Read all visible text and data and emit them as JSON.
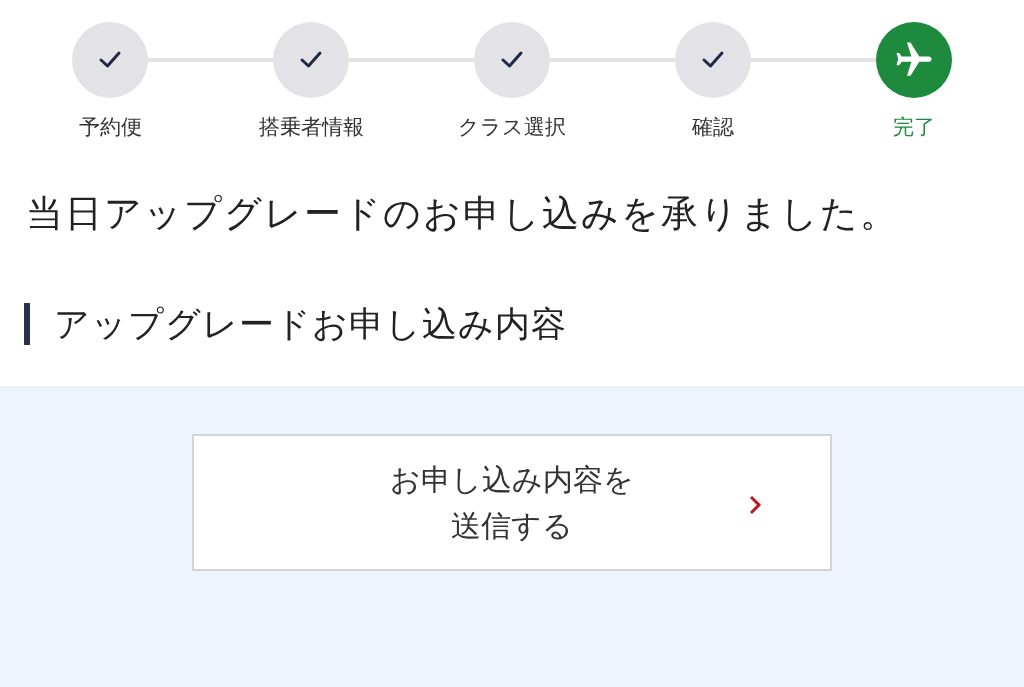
{
  "steps": [
    {
      "label": "予約便",
      "kind": "done"
    },
    {
      "label": "搭乗者情報",
      "kind": "done"
    },
    {
      "label": "クラス選択",
      "kind": "done"
    },
    {
      "label": "確認",
      "kind": "done"
    },
    {
      "label": "完了",
      "kind": "current"
    }
  ],
  "message": "当日アップグレードのお申し込みを承りました。",
  "section_title": "アップグレードお申し込み内容",
  "send_button": {
    "lines": [
      "お申し込み内容を",
      "送信する"
    ]
  }
}
